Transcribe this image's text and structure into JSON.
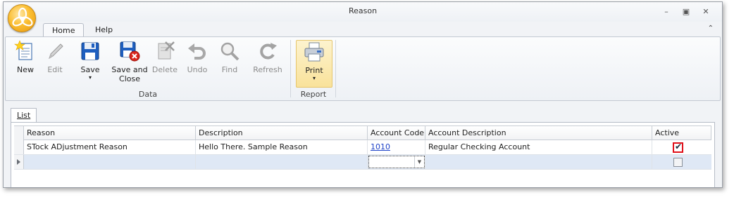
{
  "window": {
    "title": "Reason"
  },
  "window_controls": {
    "minimize": "–",
    "restore": "▣",
    "close": "✕"
  },
  "ribbon_tabs": [
    {
      "label": "Home",
      "active": true
    },
    {
      "label": "Help",
      "active": false
    }
  ],
  "ribbon_collapse": "⌃",
  "ribbon": {
    "data_group": {
      "label": "Data",
      "buttons": [
        {
          "label": "New",
          "icon": "new-document-icon",
          "enabled": true
        },
        {
          "label": "Edit",
          "icon": "pencil-icon",
          "enabled": false
        },
        {
          "label": "Save",
          "icon": "floppy-disk-icon",
          "enabled": true,
          "dropdown": "▾"
        },
        {
          "label": "Save and Close",
          "icon": "save-close-icon",
          "enabled": true
        },
        {
          "label": "Delete",
          "icon": "delete-icon",
          "enabled": false
        },
        {
          "label": "Undo",
          "icon": "undo-icon",
          "enabled": false
        },
        {
          "label": "Find",
          "icon": "magnifier-icon",
          "enabled": false
        },
        {
          "label": "Refresh",
          "icon": "refresh-icon",
          "enabled": false
        }
      ]
    },
    "report_group": {
      "label": "Report",
      "buttons": [
        {
          "label": "Print",
          "icon": "printer-icon",
          "enabled": true,
          "dropdown": "▾"
        }
      ]
    }
  },
  "list_tab": {
    "label": "List"
  },
  "grid": {
    "columns": [
      "Reason",
      "Description",
      "Account Code",
      "Account Description",
      "Active"
    ],
    "rows": [
      {
        "reason": "STock ADjustment Reason",
        "description": "Hello There. Sample Reason",
        "account_code": "1010",
        "account_description": "Regular Checking Account",
        "active": true
      }
    ],
    "new_row": {
      "active": false
    }
  },
  "colors": {
    "ribbon_accent": "#fbbf33",
    "link": "#1b3fc7",
    "checkbox_highlight": "#e0101a",
    "new_row": "#dfe8f5"
  }
}
